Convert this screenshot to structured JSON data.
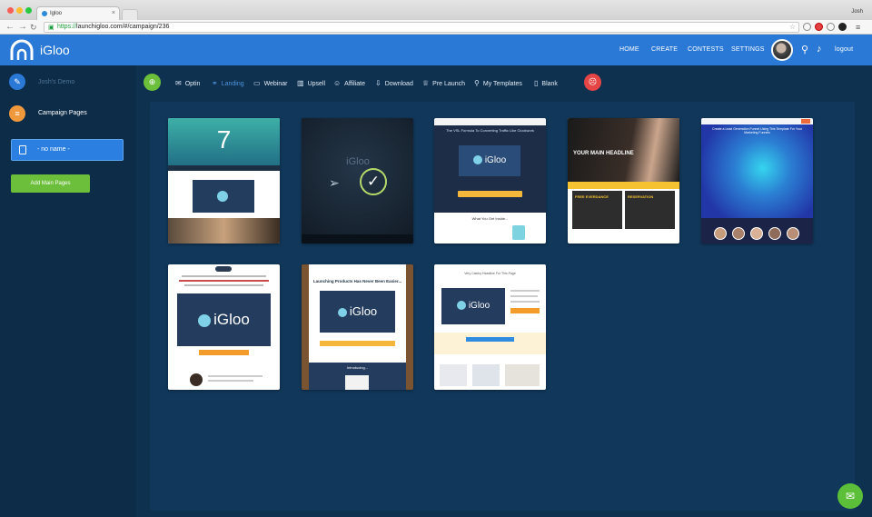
{
  "browser": {
    "tab_title": "Igloo",
    "url_secure": "https://",
    "url_rest": "launchigloo.com/#/campaign/236",
    "profile_name": "Josh"
  },
  "app": {
    "brand": "iGloo",
    "brand_color": "#2a79d6",
    "nav": [
      "HOME",
      "CREATE",
      "CONTESTS",
      "SETTINGS"
    ],
    "logout": "logout"
  },
  "sidebar": {
    "demo_label": "Josh's Demo",
    "campaign_pages": "Campaign Pages",
    "page_item": "- no name -",
    "add_button": "Add Main Pages"
  },
  "toolbar": {
    "items": [
      {
        "label": "Optin",
        "icon": "mail-icon"
      },
      {
        "label": "Landing",
        "icon": "handshake-icon",
        "active": true
      },
      {
        "label": "Webinar",
        "icon": "monitor-icon"
      },
      {
        "label": "Upsell",
        "icon": "chart-icon"
      },
      {
        "label": "Affiliate",
        "icon": "user-icon"
      },
      {
        "label": "Download",
        "icon": "download-icon"
      },
      {
        "label": "Pre Launch",
        "icon": "trophy-icon"
      },
      {
        "label": "My Templates",
        "icon": "pin-icon"
      },
      {
        "label": "Blank",
        "icon": "file-icon"
      }
    ]
  },
  "templates": {
    "t1": {
      "number": "7"
    },
    "t2": {
      "label": "iGloo"
    },
    "t3": {
      "headline": "The VSL Formula To Converting Traffic Like Clockwork",
      "brand": "iGloo",
      "section": "What You Get Inside..."
    },
    "t4": {
      "headline": "YOUR MAIN HEADLINE",
      "box1": "FREE EVERDANCE",
      "box2": "RESERVATION"
    },
    "t5": {
      "headline": "Create a Lead Generation Funnel Using This Template For Your Marketing Funnels"
    },
    "t6": {
      "brand": "iGloo"
    },
    "t7": {
      "headline": "Launching Products Has Never Been Easier...",
      "brand": "iGloo",
      "footer": "Introducing..."
    },
    "t8": {
      "brand": "iGloo",
      "headline": "Very Catchy Headline For This Page"
    }
  }
}
